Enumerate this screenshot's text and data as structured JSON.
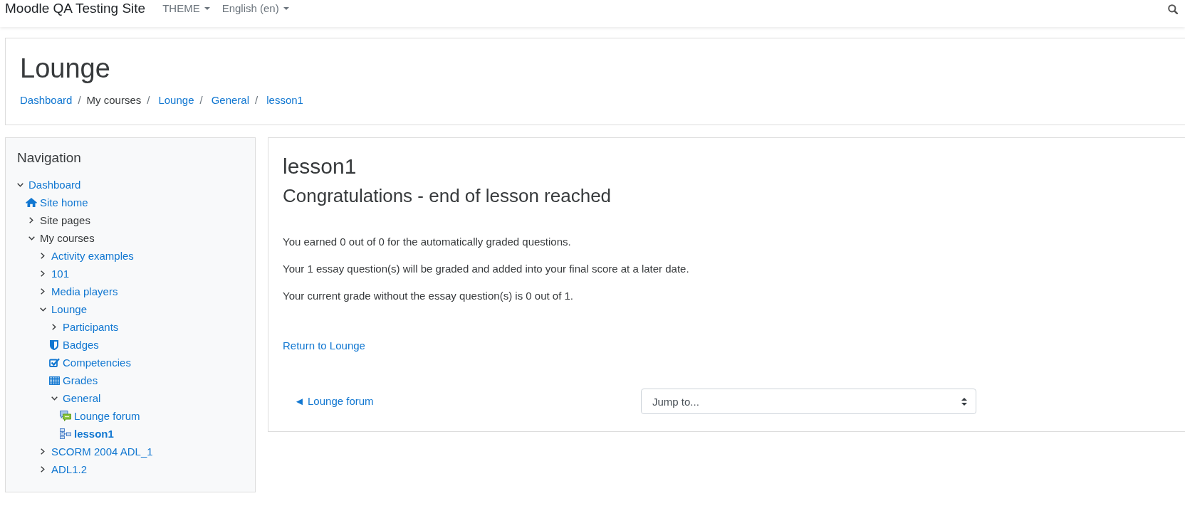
{
  "navbar": {
    "site_name": "Moodle QA Testing Site",
    "menus": [
      {
        "label": "THEME"
      },
      {
        "label": "English (en)"
      }
    ]
  },
  "page_header": {
    "title": "Lounge",
    "breadcrumb": {
      "separator": "/",
      "items": [
        {
          "label": "Dashboard",
          "link": true
        },
        {
          "label": "My courses",
          "link": false
        },
        {
          "label": "Lounge",
          "link": true
        },
        {
          "label": "General",
          "link": true
        },
        {
          "label": "lesson1",
          "link": true
        }
      ]
    }
  },
  "navigation": {
    "title": "Navigation",
    "items": [
      {
        "label": "Dashboard",
        "kind": "branch",
        "expanded": true,
        "link": true,
        "selected": false,
        "children": [
          {
            "label": "Site home",
            "kind": "home",
            "link": true,
            "selected": false
          },
          {
            "label": "Site pages",
            "kind": "branch",
            "expanded": false,
            "link": false,
            "selected": false
          },
          {
            "label": "My courses",
            "kind": "branch",
            "expanded": true,
            "link": false,
            "selected": false,
            "children": [
              {
                "label": "Activity examples",
                "kind": "branch",
                "expanded": false,
                "link": true,
                "selected": false
              },
              {
                "label": "101",
                "kind": "branch",
                "expanded": false,
                "link": true,
                "selected": false
              },
              {
                "label": "Media players",
                "kind": "branch",
                "expanded": false,
                "link": true,
                "selected": false
              },
              {
                "label": "Lounge",
                "kind": "branch",
                "expanded": true,
                "link": true,
                "selected": false,
                "children": [
                  {
                    "label": "Participants",
                    "kind": "branch",
                    "expanded": false,
                    "link": true,
                    "selected": false
                  },
                  {
                    "label": "Badges",
                    "kind": "badges",
                    "link": true,
                    "selected": false
                  },
                  {
                    "label": "Competencies",
                    "kind": "competencies",
                    "link": true,
                    "selected": false
                  },
                  {
                    "label": "Grades",
                    "kind": "grades",
                    "link": true,
                    "selected": false
                  },
                  {
                    "label": "General",
                    "kind": "branch",
                    "expanded": true,
                    "link": true,
                    "selected": false,
                    "children": [
                      {
                        "label": "Lounge forum",
                        "kind": "forum",
                        "link": true,
                        "selected": false
                      },
                      {
                        "label": "lesson1",
                        "kind": "lesson",
                        "link": true,
                        "selected": true
                      }
                    ]
                  }
                ]
              },
              {
                "label": "SCORM 2004 ADL_1",
                "kind": "branch",
                "expanded": false,
                "link": true,
                "selected": false
              },
              {
                "label": "ADL1.2",
                "kind": "branch",
                "expanded": false,
                "link": true,
                "selected": false
              }
            ]
          }
        ]
      }
    ]
  },
  "content": {
    "title": "lesson1",
    "heading": "Congratulations - end of lesson reached",
    "paragraphs": [
      "You earned 0 out of 0 for the automatically graded questions.",
      "Your 1 essay question(s) will be graded and added into your final score at a later date.",
      "Your current grade without the essay question(s) is 0 out of 1."
    ],
    "return_link": "Return to Lounge",
    "prev_link": "◄ Lounge forum",
    "jump_select": {
      "value": "Jump to..."
    }
  }
}
